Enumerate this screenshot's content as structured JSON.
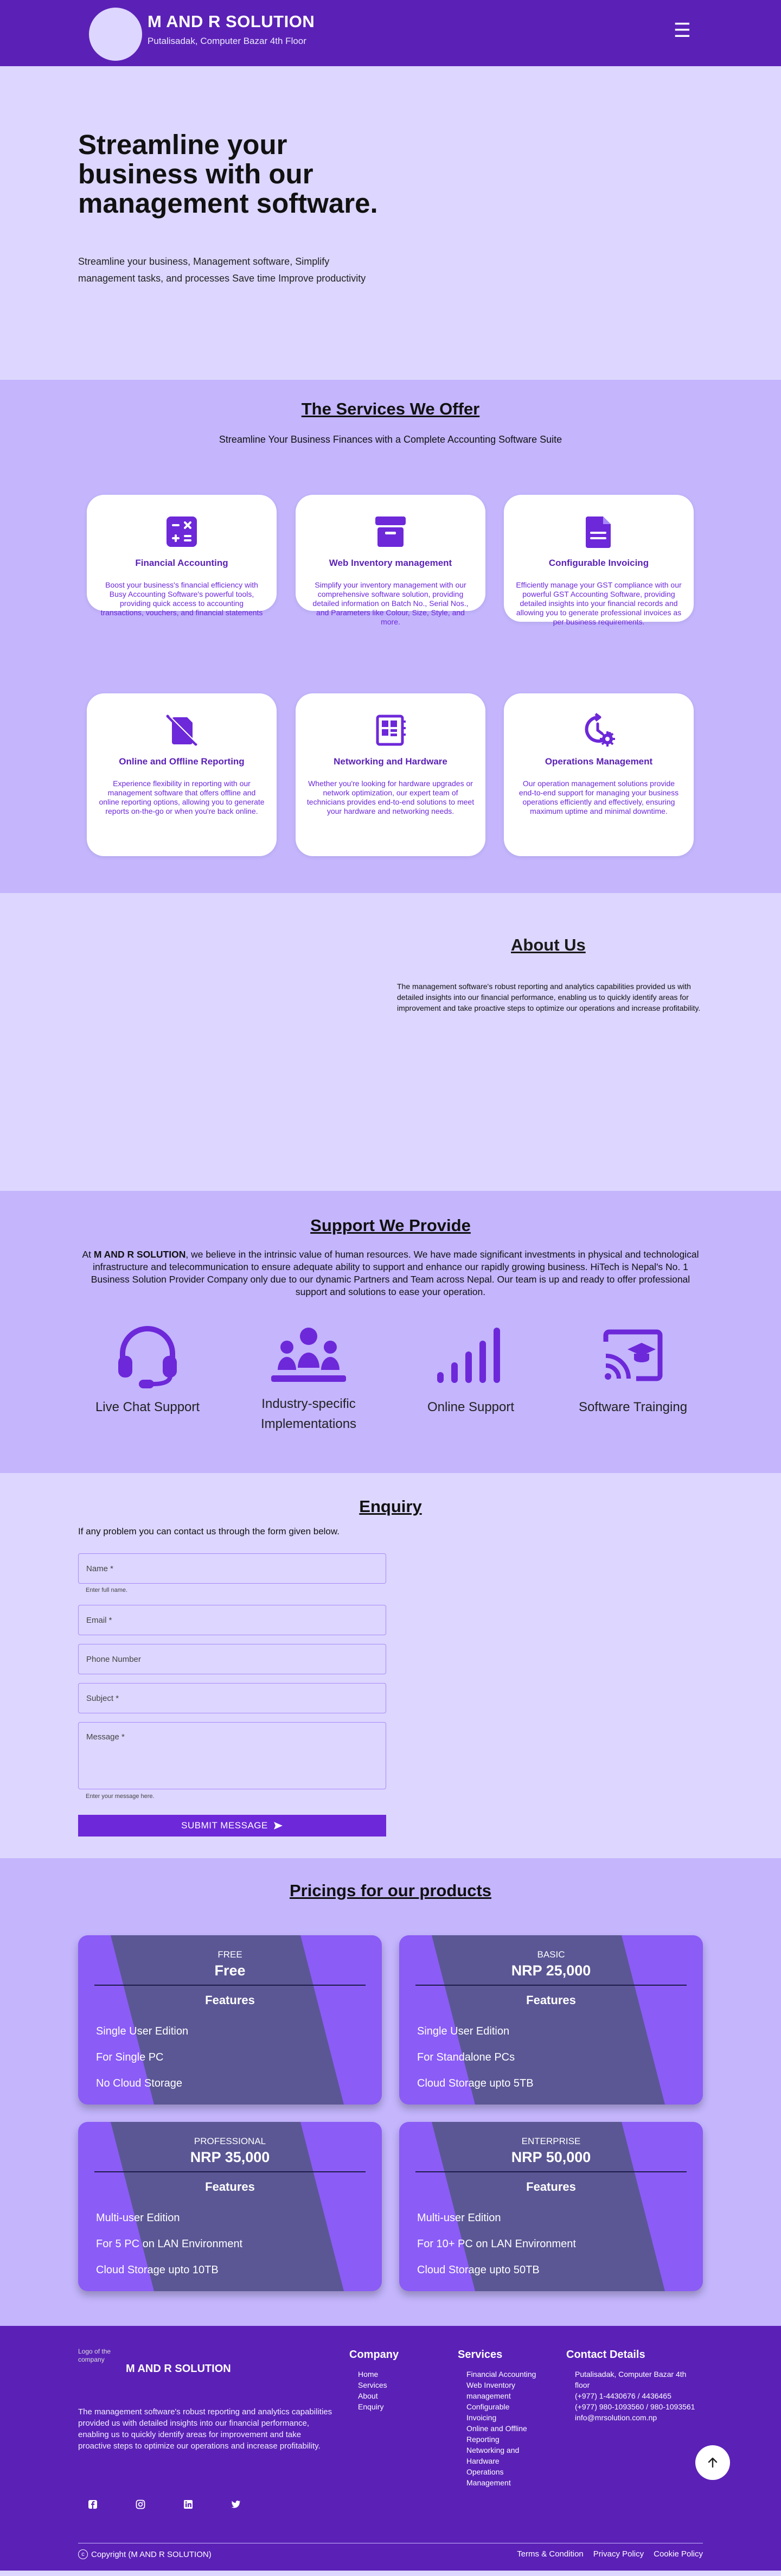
{
  "header": {
    "brand_name": "M AND R SOLUTION",
    "brand_address": "Putalisadak, Computer Bazar 4th Floor",
    "menu_icon": "hamburger-icon"
  },
  "hero": {
    "title": "Streamline your business with our management software.",
    "subtitle": "Streamline your business, Management software, Simplify management tasks, and processes Save time Improve productivity"
  },
  "services": {
    "title": "The Services We Offer",
    "subtitle": "Streamline Your Business Finances with a Complete Accounting Software Suite",
    "items": [
      {
        "title": "Financial Accounting",
        "icon": "calculator-icon",
        "text": "Boost your business's financial efficiency with Busy Accounting Software's powerful tools, providing quick access to accounting transactions, vouchers, and financial statements"
      },
      {
        "title": "Web Inventory management",
        "icon": "inventory-box-icon",
        "text": "Simplify your inventory management with our comprehensive software solution, providing detailed information on Batch No., Serial Nos., and Parameters like Colour, Size, Style, and more."
      },
      {
        "title": "Configurable Invoicing",
        "icon": "invoice-document-icon",
        "text": "Efficiently manage your GST compliance with our powerful GST Accounting Software, providing detailed insights into your financial records and allowing you to generate professional invoices as per business requirements."
      },
      {
        "title": "Online and Offline Reporting",
        "icon": "offline-report-icon",
        "text": "Experience flexibility in reporting with our management software that offers offline and online reporting options, allowing you to generate reports on-the-go or when you're back online."
      },
      {
        "title": "Networking and Hardware",
        "icon": "hardware-chip-icon",
        "text": "Whether you're looking for hardware upgrades or network optimization, our expert team of technicians provides end-to-end solutions to meet your hardware and networking needs."
      },
      {
        "title": "Operations Management",
        "icon": "operations-gear-icon",
        "text": "Our operation management solutions provide end-to-end support for managing your business operations efficiently and effectively, ensuring maximum uptime and minimal downtime."
      }
    ]
  },
  "about": {
    "title": "About Us",
    "text": "The management software's robust reporting and analytics capabilities provided us with detailed insights into our financial performance, enabling us to quickly identify areas for improvement and take proactive steps to optimize our operations and increase profitability."
  },
  "support": {
    "title": "Support We Provide",
    "lead_prefix": "At ",
    "lead_brand": "M AND R SOLUTION",
    "lead_rest": ", we believe in the intrinsic value of human resources. We have made significant investments in physical and technological infrastructure and telecommunication to ensure adequate ability to support and enhance our rapidly growing business. HiTech is Nepal's No. 1 Business Solution Provider Company only due to our dynamic Partners and Team across Nepal. Our team is up and ready to offer professional support and solutions to ease your operation.",
    "items": [
      {
        "label": "Live Chat Support",
        "icon": "headset-icon"
      },
      {
        "label": "Industry-specific Implementations",
        "icon": "team-icon"
      },
      {
        "label": "Online Support",
        "icon": "signal-bars-icon"
      },
      {
        "label": "Software Trainging",
        "icon": "cast-education-icon"
      }
    ]
  },
  "enquiry": {
    "title": "Enquiry",
    "intro": "If any problem you can contact us through the form given below.",
    "name_placeholder": "Name *",
    "name_hint": "Enter full name.",
    "email_placeholder": "Email *",
    "phone_placeholder": "Phone Number",
    "subject_placeholder": "Subject *",
    "message_placeholder": "Message *",
    "message_hint": "Enter your message here.",
    "submit_label": "SUBMIT MESSAGE",
    "submit_icon": "send-icon"
  },
  "pricing": {
    "title": "Pricings for our products",
    "features_label": "Features",
    "plans": [
      {
        "tier": "FREE",
        "price": "Free",
        "features": [
          "Single User Edition",
          "For Single PC",
          "No Cloud Storage"
        ]
      },
      {
        "tier": "BASIC",
        "price": "NRP 25,000",
        "features": [
          "Single User Edition",
          "For Standalone PCs",
          "Cloud Storage upto 5TB"
        ]
      },
      {
        "tier": "PROFESSIONAL",
        "price": "NRP 35,000",
        "features": [
          "Multi-user Edition",
          "For 5 PC on LAN Environment",
          "Cloud Storage upto 10TB"
        ]
      },
      {
        "tier": "ENTERPRISE",
        "price": "NRP 50,000",
        "features": [
          "Multi-user Edition",
          "For 10+ PC on LAN Environment",
          "Cloud Storage upto 50TB"
        ]
      }
    ]
  },
  "footer": {
    "logo_alt": "Logo of the company",
    "brand_name": "M AND R SOLUTION",
    "about": "The management software's robust reporting and analytics capabilities provided us with detailed insights into our financial performance, enabling us to quickly identify areas for improvement and take proactive steps to optimize our operations and increase profitability.",
    "company_title": "Company",
    "company_links": [
      "Home",
      "Services",
      "About",
      "Enquiry"
    ],
    "services_title": "Services",
    "services_links": [
      "Financial Accounting",
      "Web Inventory management",
      "Configurable Invoicing",
      "Online and Offline Reporting",
      "Networking and Hardware",
      "Operations Management"
    ],
    "contact_title": "Contact Details",
    "contact_lines": [
      "Putalisadak, Computer Bazar 4th floor",
      "(+977) 1-4430676 / 4436465",
      "(+977) 980-1093560 / 980-1093561",
      "info@mrsolution.com.np"
    ],
    "copyright": "Copyright (M AND R SOLUTION)",
    "legal_links": [
      "Terms & Condition",
      "Privacy Policy",
      "Cookie Policy"
    ],
    "social_icons": [
      "facebook-icon",
      "instagram-icon",
      "linkedin-icon",
      "twitter-icon"
    ]
  }
}
